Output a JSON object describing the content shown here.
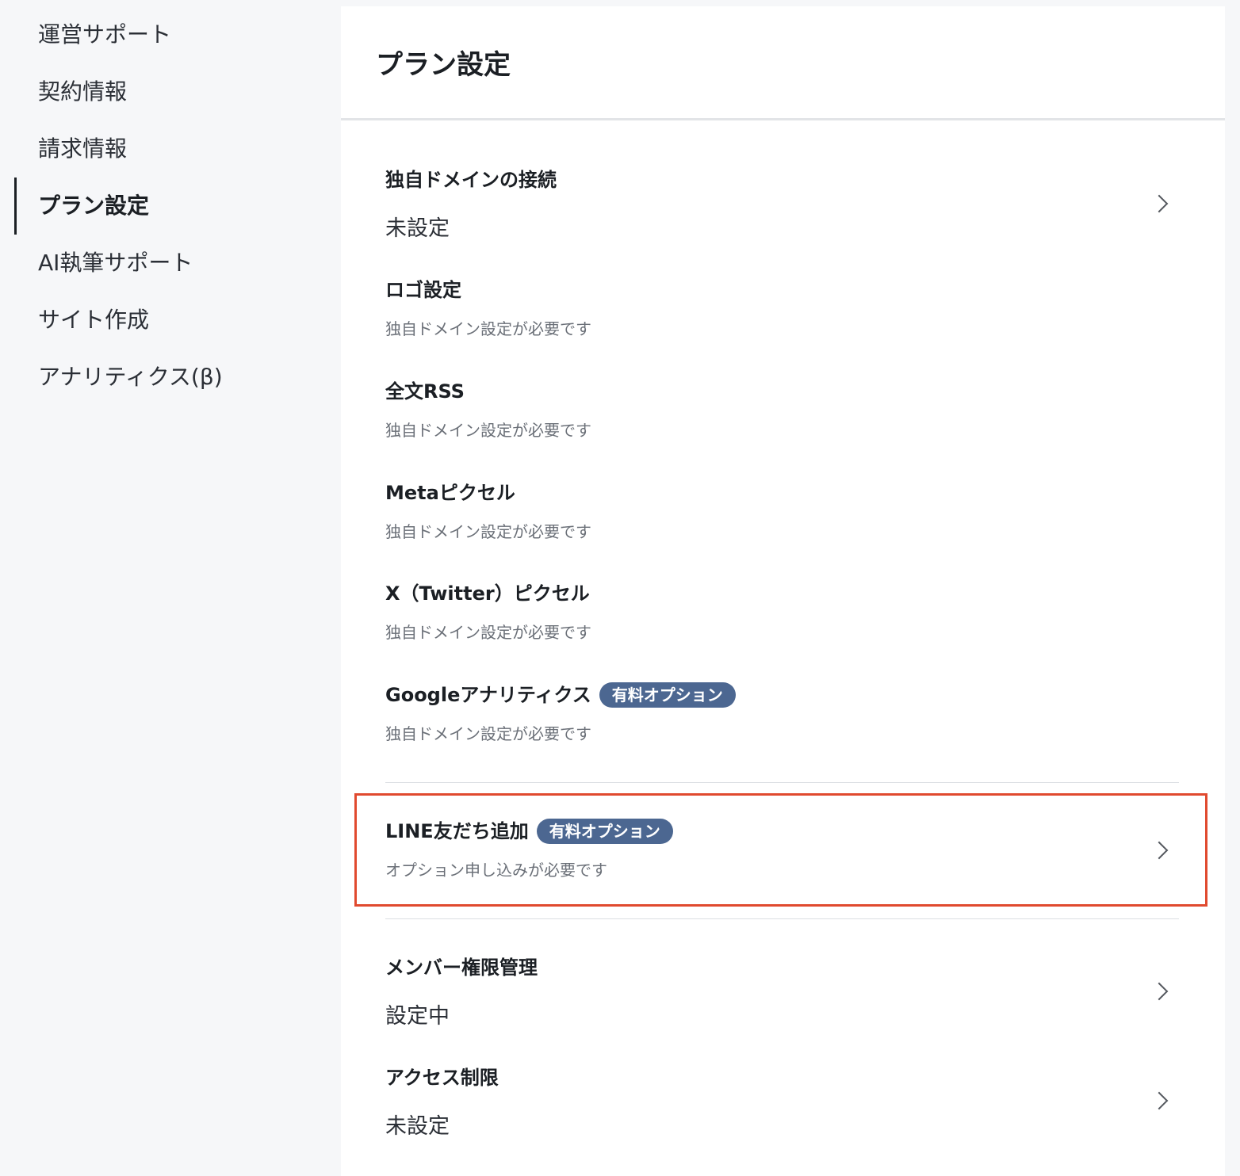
{
  "sidebar": {
    "items": [
      {
        "label": "運営サポート",
        "active": false
      },
      {
        "label": "契約情報",
        "active": false
      },
      {
        "label": "請求情報",
        "active": false
      },
      {
        "label": "プラン設定",
        "active": true
      },
      {
        "label": "AI執筆サポート",
        "active": false
      },
      {
        "label": "サイト作成",
        "active": false
      },
      {
        "label": "アナリティクス(β)",
        "active": false
      }
    ]
  },
  "main": {
    "title": "プラン設定",
    "settings": {
      "custom_domain": {
        "title": "独自ドメインの接続",
        "value": "未設定"
      },
      "logo": {
        "title": "ロゴ設定",
        "note": "独自ドメイン設定が必要です"
      },
      "full_rss": {
        "title": "全文RSS",
        "note": "独自ドメイン設定が必要です"
      },
      "meta_pixel": {
        "title": "Metaピクセル",
        "note": "独自ドメイン設定が必要です"
      },
      "x_pixel": {
        "title": "X（Twitter）ピクセル",
        "note": "独自ドメイン設定が必要です"
      },
      "google_analytics": {
        "title": "Googleアナリティクス",
        "badge": "有料オプション",
        "note": "独自ドメイン設定が必要です"
      },
      "line_friend": {
        "title": "LINE友だち追加",
        "badge": "有料オプション",
        "note": "オプション申し込みが必要です"
      },
      "member_permissions": {
        "title": "メンバー権限管理",
        "value": "設定中"
      },
      "access_restriction": {
        "title": "アクセス制限",
        "value": "未設定"
      }
    }
  },
  "colors": {
    "badge": "#4c6791",
    "highlight": "#e04a2f",
    "background": "#f6f7f9"
  }
}
